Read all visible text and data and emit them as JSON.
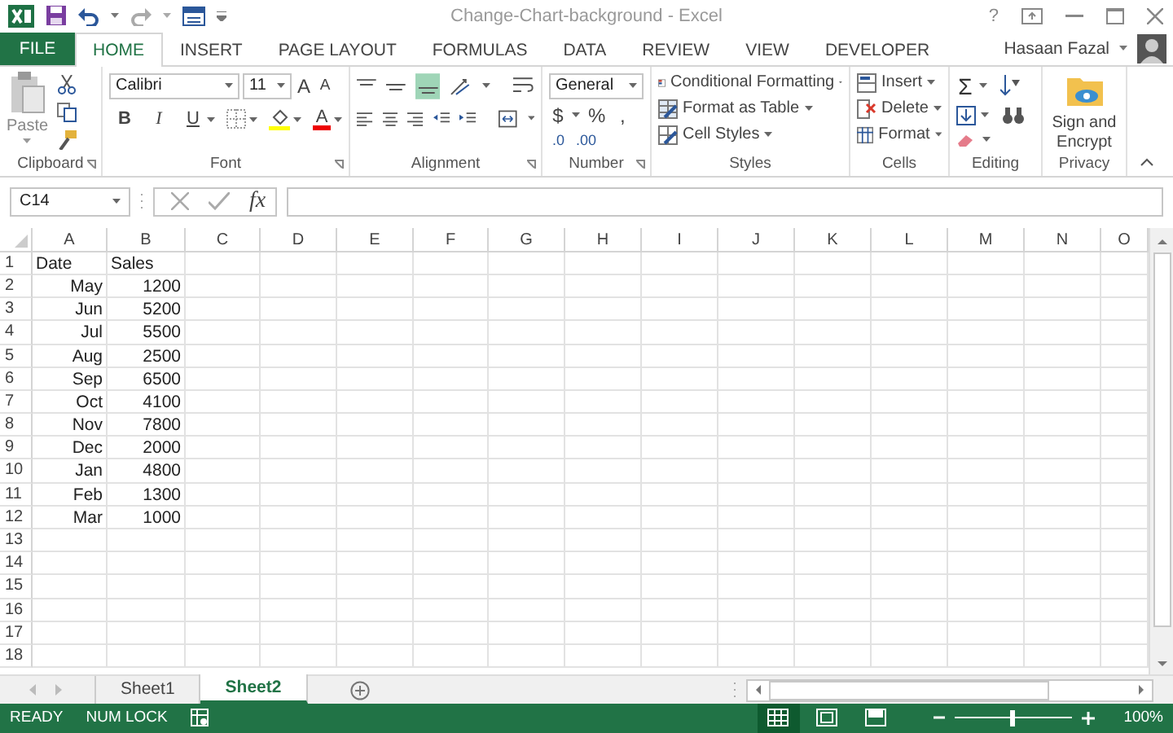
{
  "window": {
    "title": "Change-Chart-background - Excel",
    "help": "?"
  },
  "ribbon_tabs": [
    {
      "label": "FILE",
      "kind": "file",
      "selected": false
    },
    {
      "label": "HOME",
      "kind": "tab",
      "selected": true
    },
    {
      "label": "INSERT",
      "kind": "tab",
      "selected": false
    },
    {
      "label": "PAGE LAYOUT",
      "kind": "tab",
      "selected": false
    },
    {
      "label": "FORMULAS",
      "kind": "tab",
      "selected": false
    },
    {
      "label": "DATA",
      "kind": "tab",
      "selected": false
    },
    {
      "label": "REVIEW",
      "kind": "tab",
      "selected": false
    },
    {
      "label": "VIEW",
      "kind": "tab",
      "selected": false
    },
    {
      "label": "DEVELOPER",
      "kind": "tab",
      "selected": false
    }
  ],
  "user": {
    "name": "Hasaan Fazal"
  },
  "ribbon": {
    "clipboard": {
      "label": "Clipboard",
      "paste": "Paste"
    },
    "font": {
      "label": "Font",
      "name": "Calibri",
      "size": "11",
      "bold": "B",
      "italic": "I",
      "underline": "U",
      "grow": "A",
      "shrink": "A",
      "font_color_label": "A"
    },
    "alignment": {
      "label": "Alignment"
    },
    "number": {
      "label": "Number",
      "format": "General",
      "currency": "$",
      "percent": "%",
      "comma": ",",
      "increase_decimal": ".0",
      "decrease_decimal": ".00"
    },
    "styles": {
      "label": "Styles",
      "buttons": [
        "Conditional Formatting",
        "Format as Table",
        "Cell Styles"
      ]
    },
    "cells": {
      "label": "Cells",
      "buttons": [
        "Insert",
        "Delete",
        "Format"
      ]
    },
    "editing": {
      "label": "Editing",
      "sum": "Σ"
    },
    "privacy": {
      "label": "Privacy",
      "button": "Sign and Encrypt"
    }
  },
  "formula_bar": {
    "name_box": "C14",
    "fx": "fx"
  },
  "sheet": {
    "columns": [
      "A",
      "B",
      "C",
      "D",
      "E",
      "F",
      "G",
      "H",
      "I",
      "J",
      "K",
      "L",
      "M",
      "N",
      "O"
    ],
    "rows": [
      {
        "number": "1",
        "kind": "header",
        "cells": [
          "Date",
          "Sales"
        ]
      },
      {
        "number": "2",
        "kind": "data",
        "cells": [
          "May",
          "1200"
        ]
      },
      {
        "number": "3",
        "kind": "data",
        "cells": [
          "Jun",
          "5200"
        ]
      },
      {
        "number": "4",
        "kind": "data",
        "cells": [
          "Jul",
          "5500"
        ]
      },
      {
        "number": "5",
        "kind": "data",
        "cells": [
          "Aug",
          "2500"
        ]
      },
      {
        "number": "6",
        "kind": "data",
        "cells": [
          "Sep",
          "6500"
        ]
      },
      {
        "number": "7",
        "kind": "data",
        "cells": [
          "Oct",
          "4100"
        ]
      },
      {
        "number": "8",
        "kind": "data",
        "cells": [
          "Nov",
          "7800"
        ]
      },
      {
        "number": "9",
        "kind": "data",
        "cells": [
          "Dec",
          "2000"
        ]
      },
      {
        "number": "10",
        "kind": "data",
        "cells": [
          "Jan",
          "4800"
        ]
      },
      {
        "number": "11",
        "kind": "data",
        "cells": [
          "Feb",
          "1300"
        ]
      },
      {
        "number": "12",
        "kind": "data",
        "cells": [
          "Mar",
          "1000"
        ]
      },
      {
        "number": "13",
        "kind": "data"
      },
      {
        "number": "14",
        "kind": "data"
      },
      {
        "number": "15",
        "kind": "data"
      },
      {
        "number": "16",
        "kind": "data"
      },
      {
        "number": "17",
        "kind": "data"
      },
      {
        "number": "18",
        "kind": "data"
      }
    ]
  },
  "sheet_tabs": [
    {
      "label": "Sheet1",
      "selected": false
    },
    {
      "label": "Sheet2",
      "selected": true
    }
  ],
  "status_bar": {
    "texts": [
      "READY",
      "NUM LOCK"
    ],
    "views": [
      {
        "kind": "normal",
        "selected": true
      },
      {
        "kind": "page_layout",
        "selected": false
      },
      {
        "kind": "page_break",
        "selected": false
      }
    ],
    "zoom": {
      "level": 0.5,
      "reading": "100%"
    }
  }
}
